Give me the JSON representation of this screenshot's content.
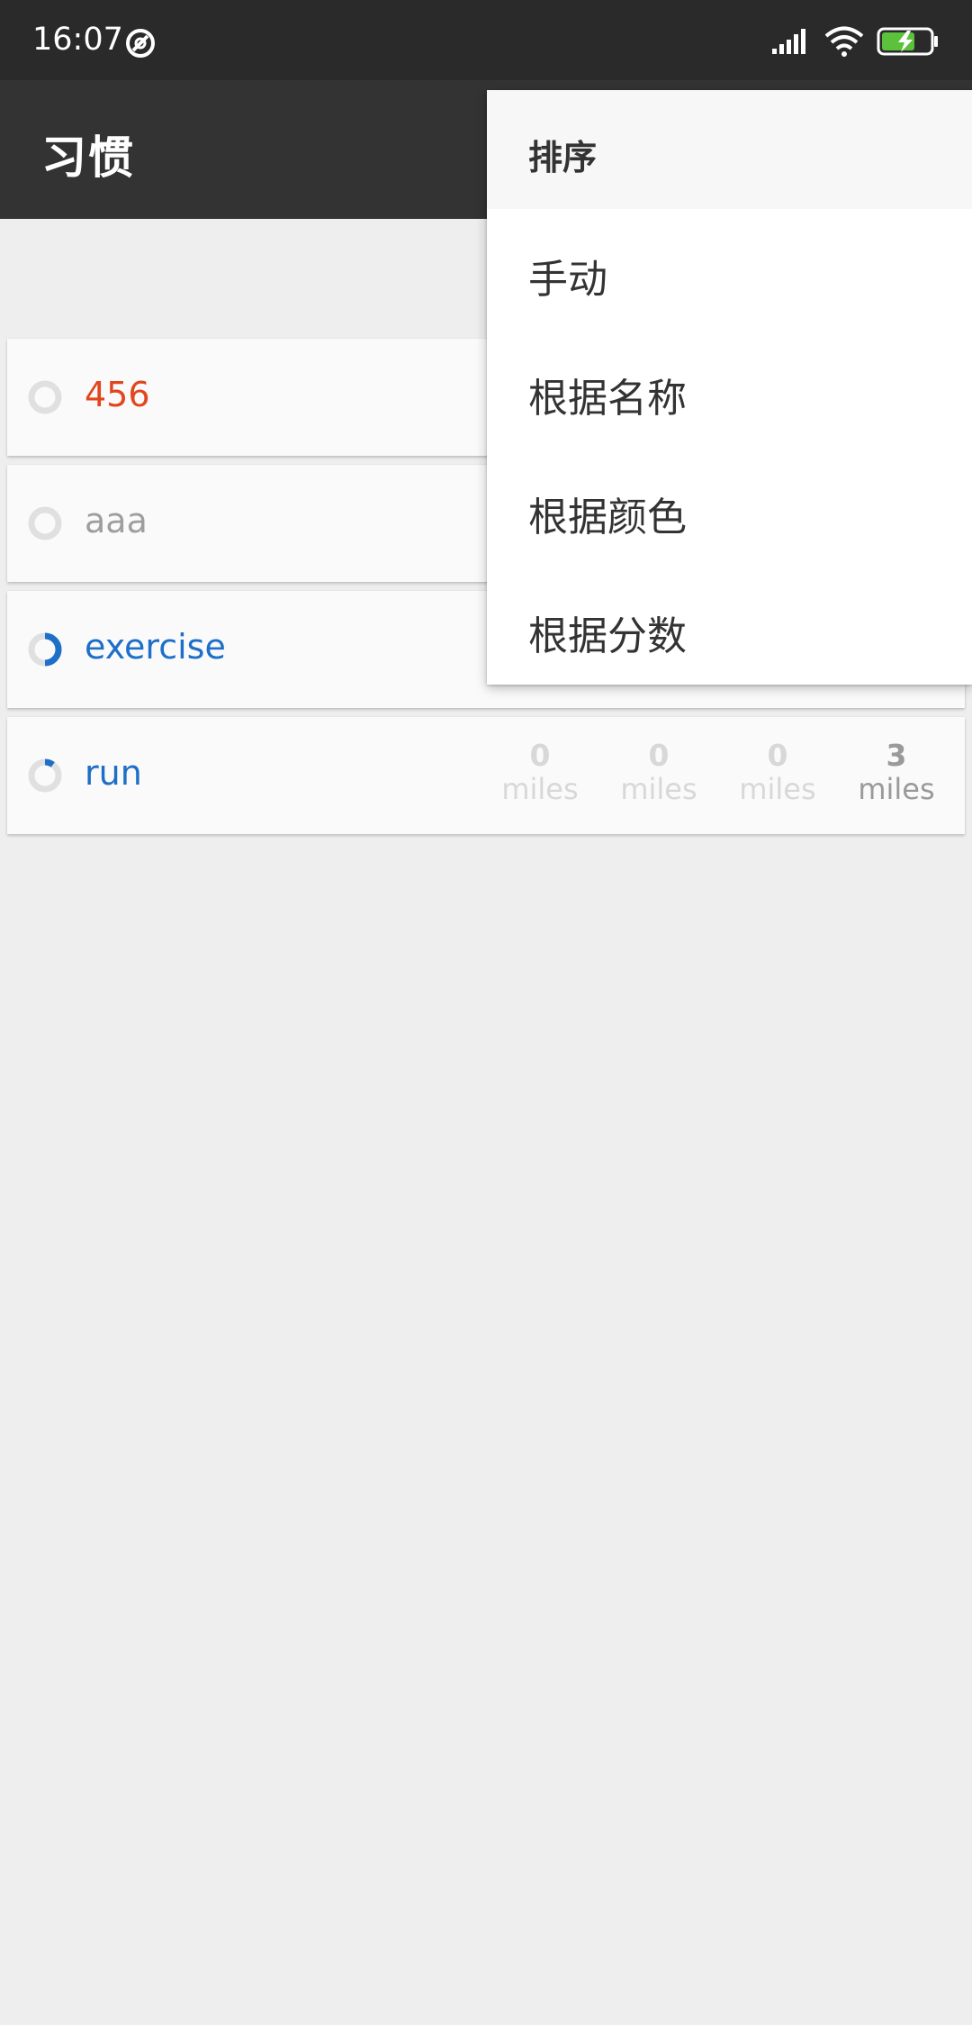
{
  "status_bar": {
    "time": "16:07"
  },
  "app_bar": {
    "title": "习惯"
  },
  "habits": [
    {
      "name": "456",
      "color": "#e2461d",
      "progress": 0
    },
    {
      "name": "aaa",
      "color": "#9e9e9e",
      "progress": 0
    },
    {
      "name": "exercise",
      "color": "#1e6fc8",
      "progress": 0.5
    },
    {
      "name": "run",
      "color": "#1e6fc8",
      "progress": 0.1,
      "checkmarks": [
        {
          "value": "0",
          "unit": "miles"
        },
        {
          "value": "0",
          "unit": "miles"
        },
        {
          "value": "0",
          "unit": "miles"
        },
        {
          "value": "3",
          "unit": "miles"
        }
      ]
    }
  ],
  "sort_menu": {
    "header": "排序",
    "items": [
      "手动",
      "根据名称",
      "根据颜色",
      "根据分数"
    ]
  },
  "colors": {
    "status_bar_bg": "#2a2a2a",
    "app_bar_bg": "#333333",
    "page_bg": "#eeeeee",
    "card_bg": "#fafafa"
  }
}
